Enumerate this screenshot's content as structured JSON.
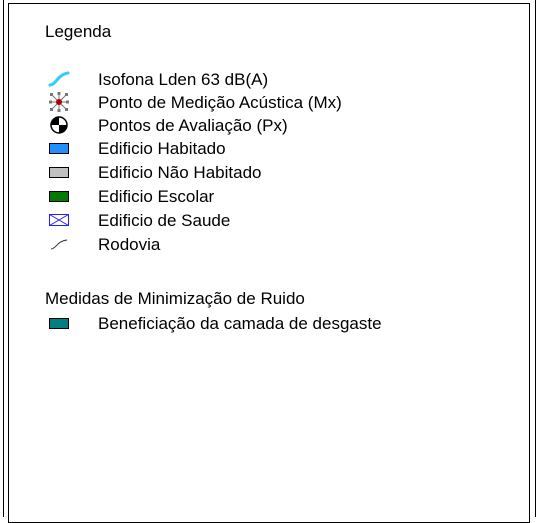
{
  "legend": {
    "title": "Legenda",
    "items": [
      {
        "label": "Isofona Lden 63 dB(A)",
        "icon": "isophone-line-icon",
        "color": "#33ccff"
      },
      {
        "label": "Ponto de Medição Acústica (Mx)",
        "icon": "measurement-point-icon"
      },
      {
        "label": "Pontos de Avaliação (Px)",
        "icon": "evaluation-point-icon"
      },
      {
        "label": "Edificio Habitado",
        "icon": "inhabited-building-icon",
        "color": "#1e90ff"
      },
      {
        "label": "Edificio Não Habitado",
        "icon": "uninhabited-building-icon",
        "color": "#c0c0c0"
      },
      {
        "label": "Edificio Escolar",
        "icon": "school-building-icon",
        "color": "#007a00"
      },
      {
        "label": "Edificio de  Saude",
        "icon": "health-building-icon",
        "color": "#2020ff"
      },
      {
        "label": "Rodovia",
        "icon": "highway-line-icon"
      }
    ],
    "measures_title": "Medidas de Minimização de Ruido",
    "measures": [
      {
        "label": "Beneficiação da camada de desgaste",
        "icon": "wearing-course-icon",
        "color": "#008080"
      }
    ]
  }
}
